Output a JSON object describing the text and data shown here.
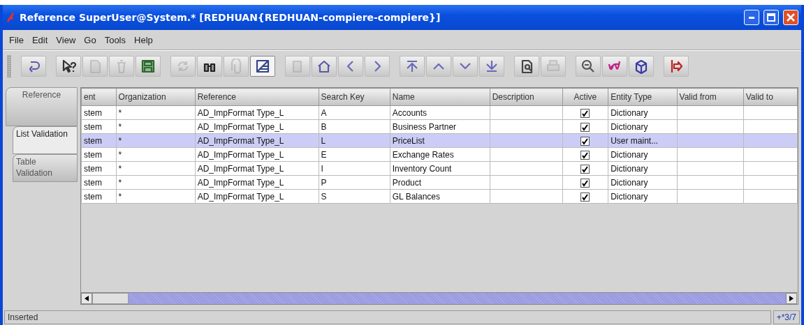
{
  "window": {
    "title": "Reference  SuperUser@System.* [REDHUAN{REDHUAN-compiere-compiere}]"
  },
  "menu": [
    "File",
    "Edit",
    "View",
    "Go",
    "Tools",
    "Help"
  ],
  "toolbar": [
    [
      {
        "disabled": false,
        "pressed": false
      }
    ],
    [
      {
        "disabled": false,
        "pressed": false
      },
      {
        "disabled": true,
        "pressed": false
      },
      {
        "disabled": true,
        "pressed": false
      },
      {
        "disabled": false,
        "pressed": false
      }
    ],
    [
      {
        "disabled": true,
        "pressed": false
      },
      {
        "disabled": false,
        "pressed": false
      },
      {
        "disabled": true,
        "pressed": false
      },
      {
        "disabled": false,
        "pressed": true
      }
    ],
    [
      {
        "disabled": true,
        "pressed": false
      },
      {
        "disabled": false,
        "pressed": false
      },
      {
        "disabled": false,
        "pressed": false
      },
      {
        "disabled": false,
        "pressed": false
      }
    ],
    [
      {
        "disabled": false,
        "pressed": false
      },
      {
        "disabled": false,
        "pressed": false
      },
      {
        "disabled": false,
        "pressed": false
      },
      {
        "disabled": false,
        "pressed": false
      }
    ],
    [
      {
        "disabled": false,
        "pressed": false
      },
      {
        "disabled": true,
        "pressed": false
      }
    ],
    [
      {
        "disabled": false,
        "pressed": false
      },
      {
        "disabled": false,
        "pressed": false
      },
      {
        "disabled": false,
        "pressed": false
      }
    ],
    [
      {
        "disabled": false,
        "pressed": false
      }
    ]
  ],
  "tabs": [
    {
      "label": "Reference",
      "selected": false,
      "children": [
        {
          "label": "List Validation",
          "selected": true
        },
        {
          "label": "Table Validation",
          "selected": false
        }
      ]
    }
  ],
  "table": {
    "columns": [
      {
        "label": "ent",
        "kind": "text"
      },
      {
        "label": "Organization",
        "kind": "text"
      },
      {
        "label": "Reference",
        "kind": "text"
      },
      {
        "label": "Search Key",
        "kind": "text"
      },
      {
        "label": "Name",
        "kind": "text"
      },
      {
        "label": "Description",
        "kind": "text"
      },
      {
        "label": "Active",
        "kind": "check"
      },
      {
        "label": "Entity Type",
        "kind": "text"
      },
      {
        "label": "Valid from",
        "kind": "text"
      },
      {
        "label": "Valid to",
        "kind": "text"
      }
    ],
    "rows": [
      {
        "selected": false,
        "cells": [
          "stem",
          "*",
          "AD_ImpFormat Type_L",
          "A",
          "Accounts",
          null,
          true,
          "Dictionary",
          null,
          null
        ]
      },
      {
        "selected": false,
        "cells": [
          "stem",
          "*",
          "AD_ImpFormat Type_L",
          "B",
          "Business Partner",
          null,
          true,
          "Dictionary",
          null,
          null
        ]
      },
      {
        "selected": true,
        "cells": [
          "stem",
          "*",
          "AD_ImpFormat Type_L",
          "L",
          "PriceList",
          null,
          true,
          "User maint...",
          null,
          null
        ]
      },
      {
        "selected": false,
        "cells": [
          "stem",
          "*",
          "AD_ImpFormat Type_L",
          "E",
          "Exchange Rates",
          null,
          true,
          "Dictionary",
          null,
          null
        ]
      },
      {
        "selected": false,
        "cells": [
          "stem",
          "*",
          "AD_ImpFormat Type_L",
          "I",
          "Inventory Count",
          null,
          true,
          "Dictionary",
          null,
          null
        ]
      },
      {
        "selected": false,
        "cells": [
          "stem",
          "*",
          "AD_ImpFormat Type_L",
          "P",
          "Product",
          null,
          true,
          "Dictionary",
          null,
          null
        ]
      },
      {
        "selected": false,
        "cells": [
          "stem",
          "*",
          "AD_ImpFormat Type_L",
          "S",
          "GL Balances",
          null,
          true,
          "Dictionary",
          null,
          null
        ]
      }
    ]
  },
  "status_bar": {
    "message": "Inserted",
    "record": "+*3/7"
  }
}
